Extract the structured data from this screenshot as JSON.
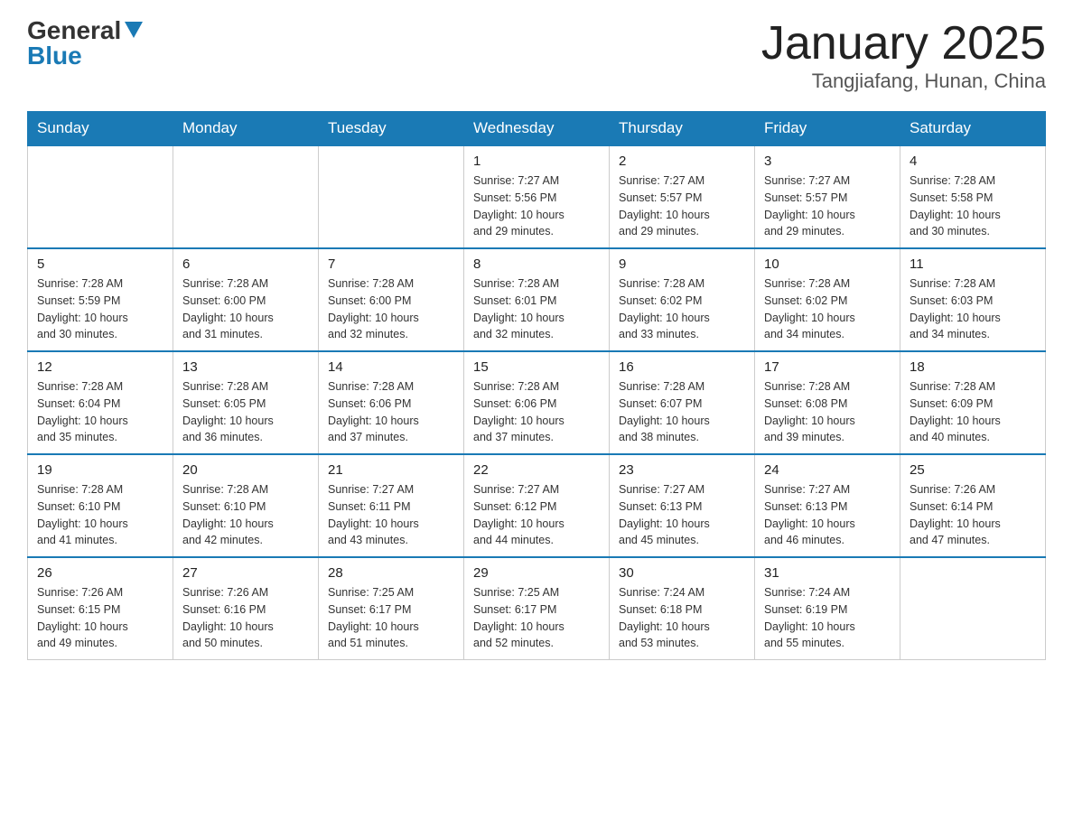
{
  "header": {
    "logo_general": "General",
    "logo_blue": "Blue",
    "month_title": "January 2025",
    "location": "Tangjiafang, Hunan, China"
  },
  "days_of_week": [
    "Sunday",
    "Monday",
    "Tuesday",
    "Wednesday",
    "Thursday",
    "Friday",
    "Saturday"
  ],
  "weeks": [
    [
      {
        "day": "",
        "info": ""
      },
      {
        "day": "",
        "info": ""
      },
      {
        "day": "",
        "info": ""
      },
      {
        "day": "1",
        "info": "Sunrise: 7:27 AM\nSunset: 5:56 PM\nDaylight: 10 hours\nand 29 minutes."
      },
      {
        "day": "2",
        "info": "Sunrise: 7:27 AM\nSunset: 5:57 PM\nDaylight: 10 hours\nand 29 minutes."
      },
      {
        "day": "3",
        "info": "Sunrise: 7:27 AM\nSunset: 5:57 PM\nDaylight: 10 hours\nand 29 minutes."
      },
      {
        "day": "4",
        "info": "Sunrise: 7:28 AM\nSunset: 5:58 PM\nDaylight: 10 hours\nand 30 minutes."
      }
    ],
    [
      {
        "day": "5",
        "info": "Sunrise: 7:28 AM\nSunset: 5:59 PM\nDaylight: 10 hours\nand 30 minutes."
      },
      {
        "day": "6",
        "info": "Sunrise: 7:28 AM\nSunset: 6:00 PM\nDaylight: 10 hours\nand 31 minutes."
      },
      {
        "day": "7",
        "info": "Sunrise: 7:28 AM\nSunset: 6:00 PM\nDaylight: 10 hours\nand 32 minutes."
      },
      {
        "day": "8",
        "info": "Sunrise: 7:28 AM\nSunset: 6:01 PM\nDaylight: 10 hours\nand 32 minutes."
      },
      {
        "day": "9",
        "info": "Sunrise: 7:28 AM\nSunset: 6:02 PM\nDaylight: 10 hours\nand 33 minutes."
      },
      {
        "day": "10",
        "info": "Sunrise: 7:28 AM\nSunset: 6:02 PM\nDaylight: 10 hours\nand 34 minutes."
      },
      {
        "day": "11",
        "info": "Sunrise: 7:28 AM\nSunset: 6:03 PM\nDaylight: 10 hours\nand 34 minutes."
      }
    ],
    [
      {
        "day": "12",
        "info": "Sunrise: 7:28 AM\nSunset: 6:04 PM\nDaylight: 10 hours\nand 35 minutes."
      },
      {
        "day": "13",
        "info": "Sunrise: 7:28 AM\nSunset: 6:05 PM\nDaylight: 10 hours\nand 36 minutes."
      },
      {
        "day": "14",
        "info": "Sunrise: 7:28 AM\nSunset: 6:06 PM\nDaylight: 10 hours\nand 37 minutes."
      },
      {
        "day": "15",
        "info": "Sunrise: 7:28 AM\nSunset: 6:06 PM\nDaylight: 10 hours\nand 37 minutes."
      },
      {
        "day": "16",
        "info": "Sunrise: 7:28 AM\nSunset: 6:07 PM\nDaylight: 10 hours\nand 38 minutes."
      },
      {
        "day": "17",
        "info": "Sunrise: 7:28 AM\nSunset: 6:08 PM\nDaylight: 10 hours\nand 39 minutes."
      },
      {
        "day": "18",
        "info": "Sunrise: 7:28 AM\nSunset: 6:09 PM\nDaylight: 10 hours\nand 40 minutes."
      }
    ],
    [
      {
        "day": "19",
        "info": "Sunrise: 7:28 AM\nSunset: 6:10 PM\nDaylight: 10 hours\nand 41 minutes."
      },
      {
        "day": "20",
        "info": "Sunrise: 7:28 AM\nSunset: 6:10 PM\nDaylight: 10 hours\nand 42 minutes."
      },
      {
        "day": "21",
        "info": "Sunrise: 7:27 AM\nSunset: 6:11 PM\nDaylight: 10 hours\nand 43 minutes."
      },
      {
        "day": "22",
        "info": "Sunrise: 7:27 AM\nSunset: 6:12 PM\nDaylight: 10 hours\nand 44 minutes."
      },
      {
        "day": "23",
        "info": "Sunrise: 7:27 AM\nSunset: 6:13 PM\nDaylight: 10 hours\nand 45 minutes."
      },
      {
        "day": "24",
        "info": "Sunrise: 7:27 AM\nSunset: 6:13 PM\nDaylight: 10 hours\nand 46 minutes."
      },
      {
        "day": "25",
        "info": "Sunrise: 7:26 AM\nSunset: 6:14 PM\nDaylight: 10 hours\nand 47 minutes."
      }
    ],
    [
      {
        "day": "26",
        "info": "Sunrise: 7:26 AM\nSunset: 6:15 PM\nDaylight: 10 hours\nand 49 minutes."
      },
      {
        "day": "27",
        "info": "Sunrise: 7:26 AM\nSunset: 6:16 PM\nDaylight: 10 hours\nand 50 minutes."
      },
      {
        "day": "28",
        "info": "Sunrise: 7:25 AM\nSunset: 6:17 PM\nDaylight: 10 hours\nand 51 minutes."
      },
      {
        "day": "29",
        "info": "Sunrise: 7:25 AM\nSunset: 6:17 PM\nDaylight: 10 hours\nand 52 minutes."
      },
      {
        "day": "30",
        "info": "Sunrise: 7:24 AM\nSunset: 6:18 PM\nDaylight: 10 hours\nand 53 minutes."
      },
      {
        "day": "31",
        "info": "Sunrise: 7:24 AM\nSunset: 6:19 PM\nDaylight: 10 hours\nand 55 minutes."
      },
      {
        "day": "",
        "info": ""
      }
    ]
  ]
}
